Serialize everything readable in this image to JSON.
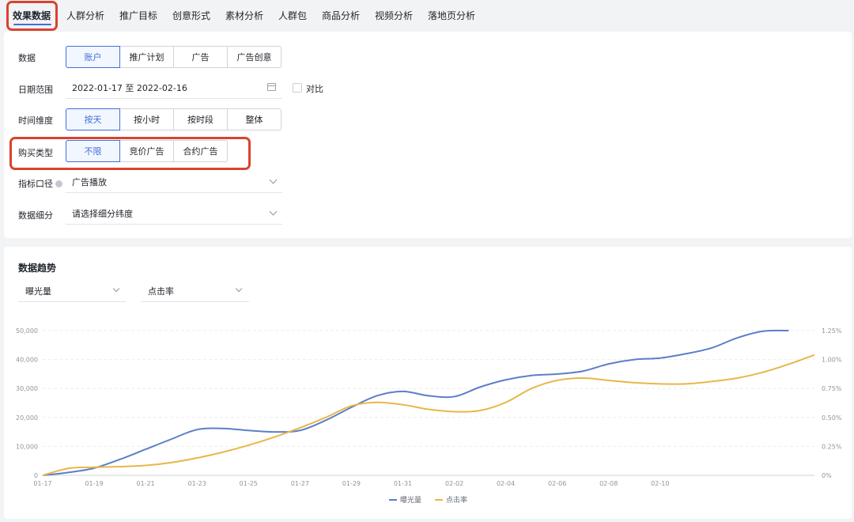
{
  "tabs": [
    "效果数据",
    "人群分析",
    "推广目标",
    "创意形式",
    "素材分析",
    "人群包",
    "商品分析",
    "视频分析",
    "落地页分析"
  ],
  "filters": {
    "data": {
      "label": "数据",
      "options": [
        "账户",
        "推广计划",
        "广告",
        "广告创意"
      ],
      "selected": "账户"
    },
    "date": {
      "label": "日期范围",
      "value": "2022-01-17 至 2022-02-16",
      "compare_label": "对比"
    },
    "time": {
      "label": "时间维度",
      "options": [
        "按天",
        "按小时",
        "按时段",
        "整体"
      ],
      "selected": "按天"
    },
    "buy": {
      "label": "购买类型",
      "options": [
        "不限",
        "竞价广告",
        "合约广告"
      ],
      "selected": "不限"
    },
    "metric_scope": {
      "label": "指标口径",
      "value": "广告播放"
    },
    "breakdown": {
      "label": "数据细分",
      "placeholder": "请选择细分纬度"
    }
  },
  "trend": {
    "title": "数据趋势",
    "metric_left": "曝光量",
    "metric_right": "点击率"
  },
  "chart_data": {
    "type": "line",
    "x": [
      "01-17",
      "01-18",
      "01-19",
      "01-20",
      "01-21",
      "01-22",
      "01-23",
      "01-24",
      "01-25",
      "01-26",
      "01-27",
      "01-28",
      "01-29",
      "01-30",
      "01-31",
      "02-01",
      "02-02",
      "02-03",
      "02-04",
      "02-05",
      "02-06",
      "02-07",
      "02-08",
      "02-09",
      "02-10",
      "02-11",
      "02-12",
      "02-13",
      "02-14",
      "02-15",
      "02-16"
    ],
    "x_tick_labels": [
      "01-17",
      "01-19",
      "01-21",
      "01-23",
      "01-25",
      "01-27",
      "01-29",
      "01-31",
      "02-02",
      "02-04",
      "02-06",
      "02-08",
      "02-10"
    ],
    "series": [
      {
        "name": "曝光量",
        "axis": "left",
        "color": "#5b7fc7",
        "values": [
          0,
          1000,
          2500,
          5500,
          9000,
          12500,
          15800,
          16200,
          15500,
          15000,
          15500,
          19000,
          23500,
          27500,
          29000,
          27500,
          27200,
          30500,
          33000,
          34500,
          35000,
          36000,
          38500,
          40000,
          40500,
          42000,
          44000,
          47500,
          49800,
          50000,
          null
        ]
      },
      {
        "name": "点击率",
        "axis": "right",
        "color": "#e8b64a",
        "values": [
          0.0,
          0.06,
          0.07,
          0.075,
          0.085,
          0.11,
          0.15,
          0.2,
          0.26,
          0.33,
          0.41,
          0.5,
          0.6,
          0.63,
          0.61,
          0.57,
          0.55,
          0.56,
          0.63,
          0.75,
          0.82,
          0.84,
          0.82,
          0.8,
          0.79,
          0.79,
          0.81,
          0.84,
          0.89,
          0.96,
          1.04
        ]
      }
    ],
    "y_left": {
      "ticks": [
        "0",
        "10,000",
        "20,000",
        "30,000",
        "40,000",
        "50,000"
      ],
      "range": [
        0,
        50000
      ]
    },
    "y_right": {
      "ticks": [
        "0%",
        "0.25%",
        "0.50%",
        "0.75%",
        "1.00%",
        "1.25%"
      ],
      "range": [
        0,
        1.25
      ]
    },
    "grid": true,
    "legend": "bottom-center"
  }
}
